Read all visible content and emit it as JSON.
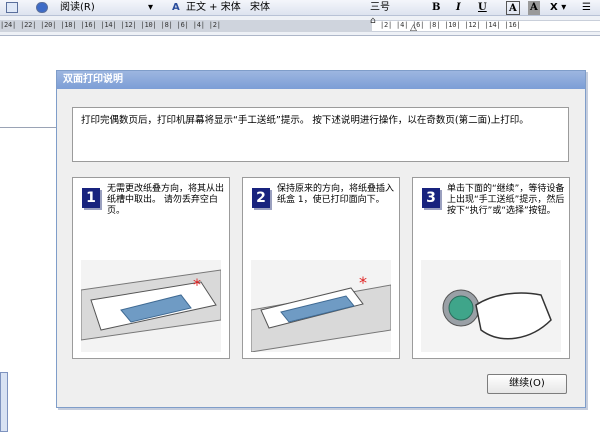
{
  "toolbar": {
    "read_label": "阅读(R)",
    "style_value": "正文 + 宋体",
    "font_value": "宋体",
    "size_value": "三号",
    "bold": "B",
    "italic": "I",
    "underline": "U",
    "font_color_letter": "A",
    "highlight_letter": "A"
  },
  "ruler": {
    "numbers": "|24| |22| |20| |18| |16| |14| |12| |10| |8| |6| |4| |2|",
    "numbers_right": "|2| |4| |6| |8| |10| |12| |14| |16|"
  },
  "dialog": {
    "title": "双面打印说明",
    "intro": "打印完偶数页后，打印机屏幕将显示“手工送纸”提示。 按下述说明进行操作，以在奇数页(第二面)上打印。",
    "steps": [
      {
        "number": "1",
        "text": "无需更改纸叠方向，将其从出纸槽中取出。 请勿丢弃空白页。"
      },
      {
        "number": "2",
        "text": "保持原来的方向，将纸叠插入纸盒 1，使已打印面向下。"
      },
      {
        "number": "3",
        "text": "单击下面的“继续”，等待设备上出现“手工送纸”提示，然后按下“执行”或“选择”按钮。"
      }
    ],
    "continue_label": "继续(O)"
  }
}
